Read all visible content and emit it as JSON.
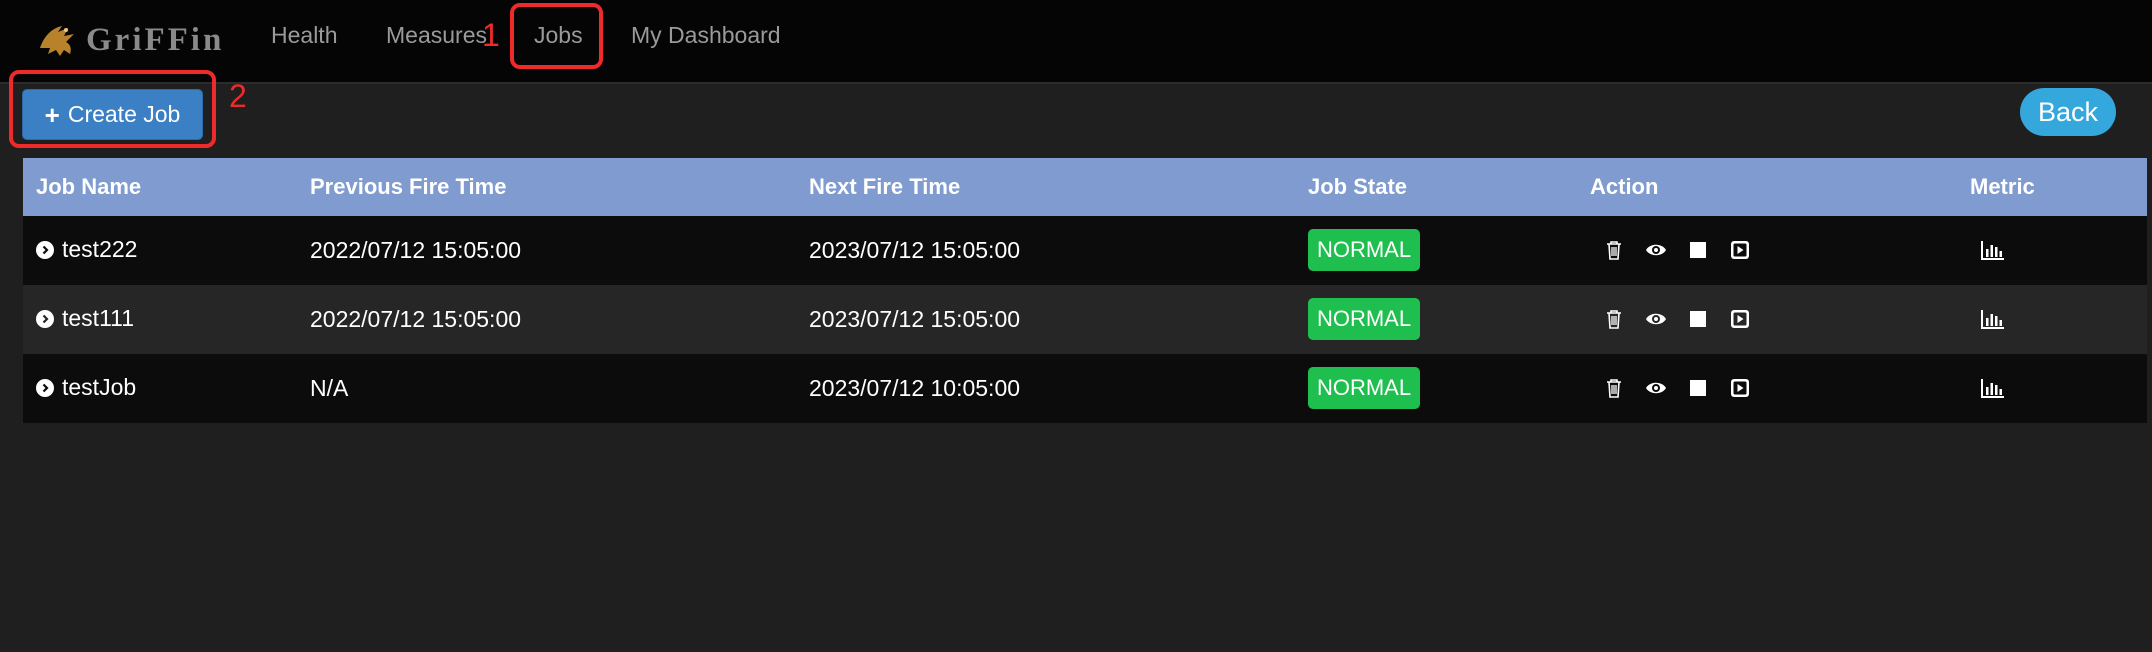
{
  "brand": {
    "name": "GriFFin"
  },
  "nav": {
    "items": [
      {
        "label": "Health"
      },
      {
        "label": "Measures"
      },
      {
        "label": "Jobs"
      },
      {
        "label": "My Dashboard"
      }
    ]
  },
  "annotations": {
    "marker_1": "1",
    "marker_2": "2"
  },
  "toolbar": {
    "create_label": "Create Job",
    "back_label": "Back"
  },
  "table": {
    "headers": [
      "Job Name",
      "Previous Fire Time",
      "Next Fire Time",
      "Job State",
      "Action",
      "Metric"
    ],
    "rows": [
      {
        "name": "test222",
        "prev": "2022/07/12 15:05:00",
        "next": "2023/07/12 15:05:00",
        "state": "NORMAL"
      },
      {
        "name": "test111",
        "prev": "2022/07/12 15:05:00",
        "next": "2023/07/12 15:05:00",
        "state": "NORMAL"
      },
      {
        "name": "testJob",
        "prev": "N/A",
        "next": "2023/07/12 10:05:00",
        "state": "NORMAL"
      }
    ]
  },
  "icons": {
    "expand": "chevron-circle-right-icon",
    "delete": "trash-icon",
    "view": "eye-icon",
    "stop": "stop-icon",
    "run": "play-icon",
    "metric": "bar-chart-icon"
  },
  "colors": {
    "header_bg": "#7f9bcf",
    "state_normal": "#1fbf4f",
    "primary_button": "#3b7fc4",
    "back_button": "#34a8dc",
    "annotation": "#ee2a2a"
  }
}
